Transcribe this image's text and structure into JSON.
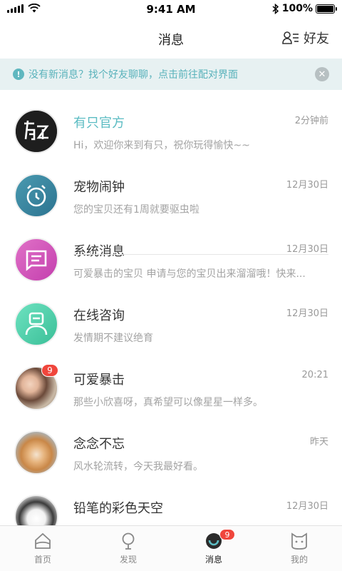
{
  "status_bar": {
    "time": "9:41 AM",
    "battery": "100%"
  },
  "header": {
    "title": "消息",
    "friends_label": "好友"
  },
  "notice": {
    "text": "没有新消息？找个好友聊聊，点击前往配对界面"
  },
  "messages": [
    {
      "name": "有只官方",
      "preview": "Hi，欢迎你来到有只，祝你玩得愉快~~",
      "time": "2分钟前"
    },
    {
      "name": "宠物闹钟",
      "preview": "您的宝贝还有1周就要驱虫啦",
      "time": "12月30日"
    },
    {
      "name": "系统消息",
      "preview": "可爱暴击的宝贝 申请与您的宝贝出来溜溜哦！快来...",
      "time": "12月30日"
    },
    {
      "name": "在线咨询",
      "preview": "发情期不建议绝育",
      "time": "12月30日"
    },
    {
      "name": "可爱暴击",
      "preview": "那些小欣喜呀，真希望可以像星星一样多。",
      "time": "20:21",
      "badge": "9"
    },
    {
      "name": "念念不忘",
      "preview": "风水轮流转，今天我最好看。",
      "time": "昨天"
    },
    {
      "name": "铅笔的彩色天空",
      "preview": "",
      "time": "12月30日"
    }
  ],
  "tabs": [
    {
      "label": "首页"
    },
    {
      "label": "发现"
    },
    {
      "label": "消息",
      "badge": "9"
    },
    {
      "label": "我的"
    }
  ],
  "colors": {
    "accent": "#5cbcc3",
    "badge": "#f0463c",
    "banner_bg": "#e7f1f2"
  }
}
